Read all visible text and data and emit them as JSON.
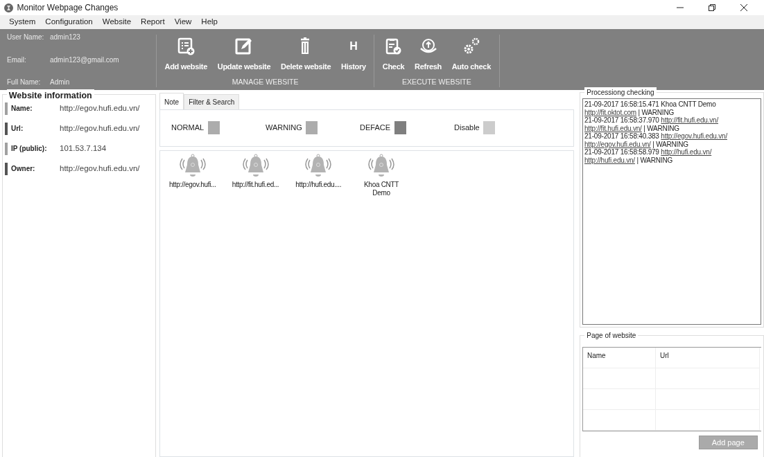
{
  "window": {
    "title": "Monitor Webpage Changes"
  },
  "menu": [
    "System",
    "Configuration",
    "Website",
    "Report",
    "View",
    "Help"
  ],
  "user": [
    {
      "label": "User Name:",
      "value": "admin123"
    },
    {
      "label": "Email:",
      "value": "admin123@gmail.com"
    },
    {
      "label": "Full Name:",
      "value": "Admin"
    }
  ],
  "toolbar_groups": [
    {
      "caption": "MANAGE WEBSITE",
      "buttons": [
        {
          "label": "Add website"
        },
        {
          "label": "Update website"
        },
        {
          "label": "Delete website"
        },
        {
          "label": "History",
          "glyph": "H"
        }
      ]
    },
    {
      "caption": "EXECUTE WEBSITE",
      "buttons": [
        {
          "label": "Check"
        },
        {
          "label": "Refresh"
        },
        {
          "label": "Auto check"
        }
      ]
    }
  ],
  "website_info": {
    "title": "Website information",
    "fields": [
      {
        "label": "Name:",
        "value": "http://egov.hufi.edu.vn/",
        "color": "#a0a0a0"
      },
      {
        "label": "Url:",
        "value": "http://egov.hufi.edu.vn/",
        "color": "#555555"
      },
      {
        "label": "IP (public):",
        "value": "101.53.7.134",
        "color": "#a0a0a0"
      },
      {
        "label": "Owner:",
        "value": "http://egov.hufi.edu.vn/",
        "color": "#555555"
      }
    ]
  },
  "tabs": [
    {
      "label": "Note",
      "selected": true
    },
    {
      "label": "Filter & Search",
      "selected": false
    }
  ],
  "legend": [
    {
      "label": "NORMAL",
      "color": "#acacac"
    },
    {
      "label": "WARNING",
      "color": "#acacac"
    },
    {
      "label": "DEFACE",
      "color": "#7f7f7f"
    },
    {
      "label": "Disable",
      "color": "#cccccc"
    }
  ],
  "websites": [
    {
      "label": "http://egov.hufi..."
    },
    {
      "label": "http://fit.hufi.ed..."
    },
    {
      "label": "http://hufi.edu...."
    },
    {
      "label": "Khoa CNTT Demo"
    }
  ],
  "processing": {
    "title": "Processiong checking",
    "log": [
      [
        {
          "kind": "text",
          "text": "21-09-2017 16:58:15.471 Khoa CNTT Demo"
        },
        {
          "kind": "link",
          "text": "http://fit.oktot.com"
        },
        {
          "kind": "text",
          "text": "| WARNING"
        }
      ],
      [
        {
          "kind": "text",
          "text": "21-09-2017 16:58:37.970"
        },
        {
          "kind": "link",
          "text": "http://fit.hufi.edu.vn/"
        },
        {
          "kind": "link",
          "text": "http://fit.hufi.edu.vn/"
        },
        {
          "kind": "text",
          "text": "| WARNING"
        }
      ],
      [
        {
          "kind": "text",
          "text": "21-09-2017 16:58:40.383"
        },
        {
          "kind": "link",
          "text": "http://egov.hufi.edu.vn/"
        },
        {
          "kind": "link",
          "text": "http://egov.hufi.edu.vn/"
        },
        {
          "kind": "text",
          "text": "| WARNING"
        }
      ],
      [
        {
          "kind": "text",
          "text": "21-09-2017 16:58:58.979"
        },
        {
          "kind": "link",
          "text": "http://hufi.edu.vn/"
        },
        {
          "kind": "link",
          "text": "http://hufi.edu.vn/"
        },
        {
          "kind": "text",
          "text": "| WARNING"
        }
      ]
    ]
  },
  "pages": {
    "title": "Page of website",
    "columns": [
      "Name",
      "Url"
    ],
    "button": "Add page"
  }
}
